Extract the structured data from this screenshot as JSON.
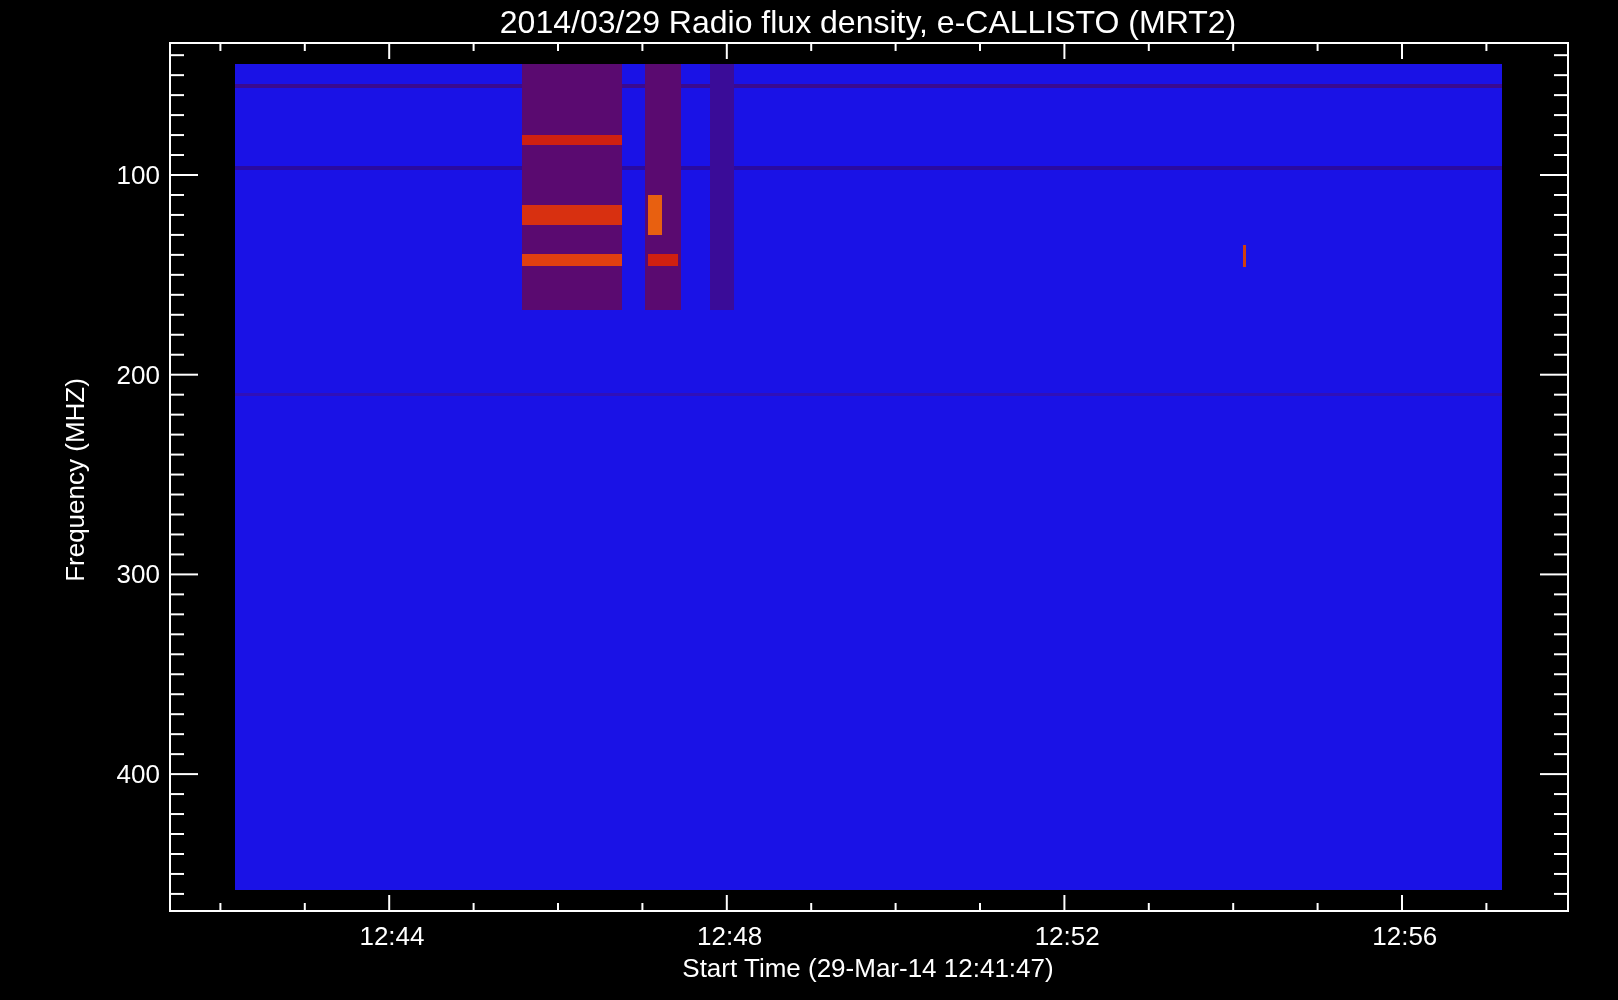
{
  "title": "2014/03/29  Radio flux density, e-CALLISTO (MRT2)",
  "xlabel": "Start Time (29-Mar-14 12:41:47)",
  "ylabel": "Frequency (MHZ)",
  "xticks": [
    "12:44",
    "12:48",
    "12:52",
    "12:56"
  ],
  "yticks": [
    "100",
    "200",
    "300",
    "400"
  ]
}
